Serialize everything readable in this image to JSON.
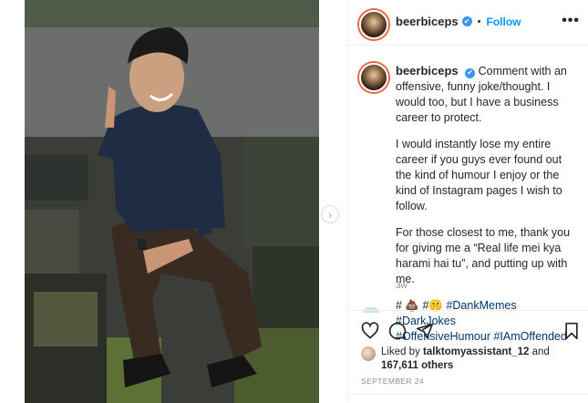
{
  "post": {
    "username": "beerbiceps",
    "follow_label": "Follow",
    "more_label": "•••",
    "verified_mark": "✔",
    "photo_alt": "Man in navy shirt sitting on mossy stone steps, smiling",
    "next_arrow": "›"
  },
  "caption": {
    "username": "beerbiceps",
    "paragraphs": [
      "Comment with an offensive, funny joke/thought. I would too, but I have a business career to protect.",
      "I would instantly lose my entire career if you guys ever found out the kind of humour I enjoy or the kind of Instagram pages I wish to follow.",
      "For those closest to me, thank you for giving me a “Real life mei kya harami hai tu”, and putting up with me."
    ],
    "tags_line1_prefix": "# 💩 #🤫 ",
    "hashtags_line1": "#DankMemes #DarkJokes",
    "hashtags_line2": "#OffensiveHumour #IAmOffended",
    "time": "3w"
  },
  "likes": {
    "prefix": "Liked by",
    "user": "talktomyassistant_12",
    "and": "and",
    "count": "167,611 others"
  },
  "date": "SEPTEMBER 24",
  "icons": {
    "like": "heart-icon",
    "comment": "comment-icon",
    "share": "share-icon",
    "save": "bookmark-icon"
  }
}
